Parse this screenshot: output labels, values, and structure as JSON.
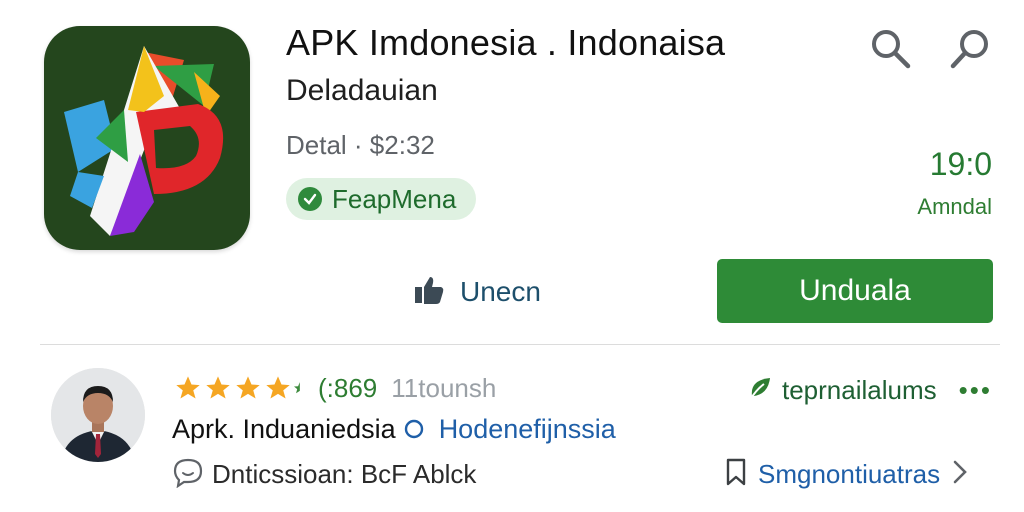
{
  "app": {
    "title": "APK Imdonesia . Indonaisa",
    "developer": "Deladauian",
    "meta": "Detal · $2:32",
    "verified_label": "FeapMena",
    "stat_value": "19:0",
    "stat_label": "Amndal"
  },
  "actions": {
    "like_label": "Unecn",
    "install_label": "Unduala"
  },
  "review": {
    "stars": 4,
    "rating_count": "(:869",
    "rating_sub": "11tounsh",
    "title_text": "Aprk. Induaniedsia",
    "title_link": "Hodenefijnssia",
    "discussion_label": "Dnticssioan: BcF Ablck",
    "tag_label": "teprnailalums",
    "more_label": "•••",
    "subscribe_label": "Smgnontiuatras"
  },
  "colors": {
    "accent_green": "#2e8b37",
    "link_blue": "#1f5fa8",
    "star": "#f5a623"
  }
}
